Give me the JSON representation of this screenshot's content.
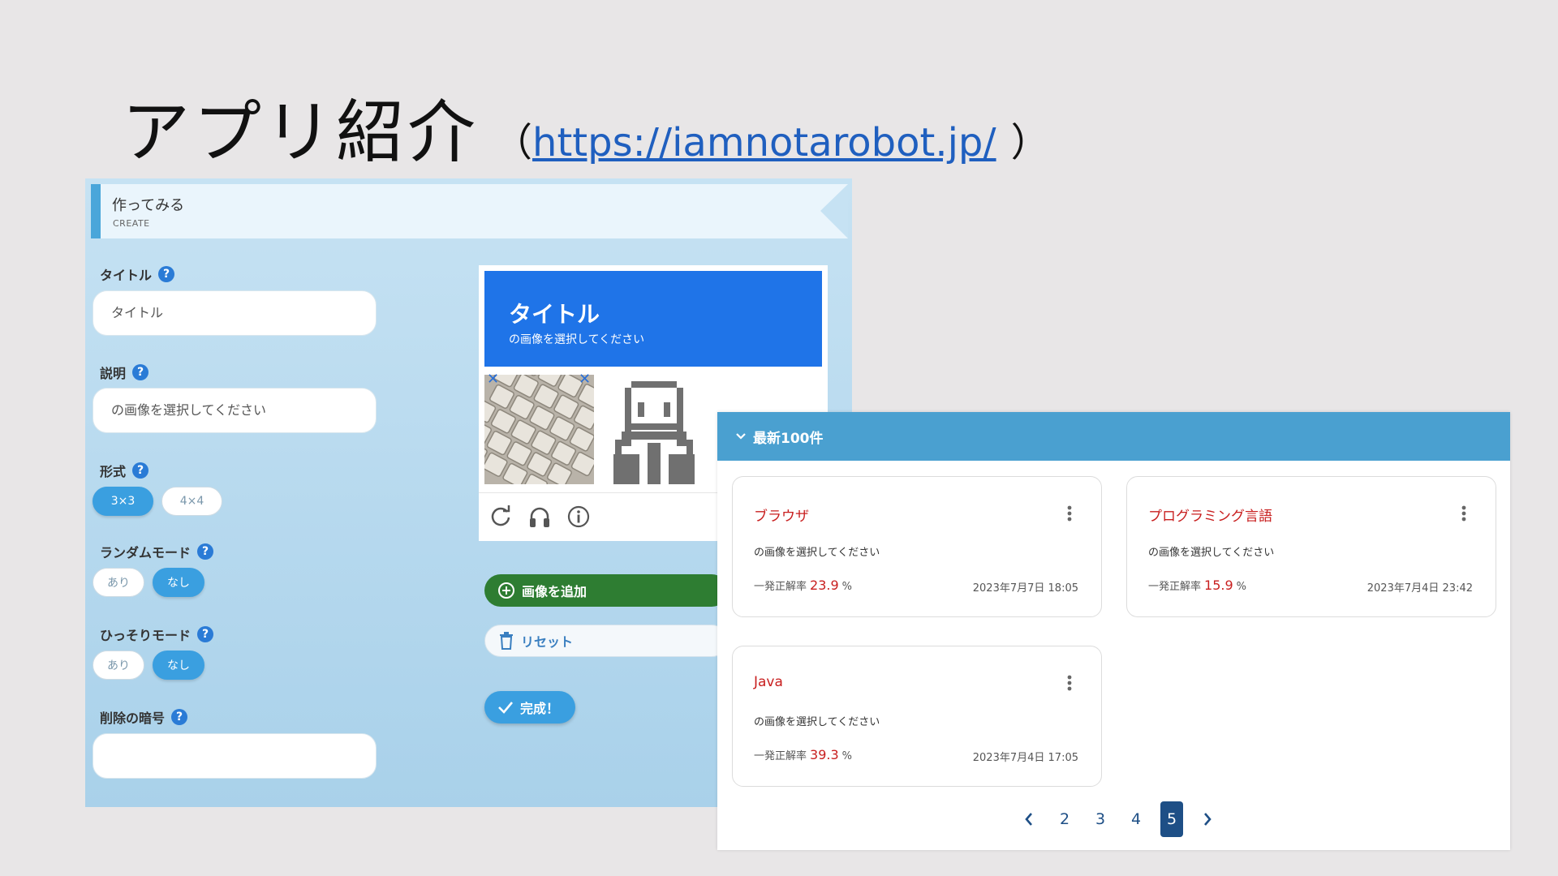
{
  "slide": {
    "title": "アプリ紹介",
    "paren_open": "（",
    "url": "https://iamnotarobot.jp/",
    "paren_close": "）"
  },
  "create": {
    "header_title": "作ってみる",
    "header_sub": "CREATE",
    "title_label": "タイトル",
    "title_value": "タイトル",
    "desc_label": "説明",
    "desc_value": "の画像を選択してください",
    "format_label": "形式",
    "format_options": [
      "3×3",
      "4×4"
    ],
    "format_selected": "3×3",
    "random_label": "ランダムモード",
    "random_options": [
      "あり",
      "なし"
    ],
    "random_selected": "なし",
    "secret_label": "ひっそりモード",
    "secret_options": [
      "あり",
      "なし"
    ],
    "secret_selected": "なし",
    "password_label": "削除の暗号",
    "password_value": "",
    "help_glyph": "?",
    "preview": {
      "title": "タイトル",
      "subtitle": "の画像を選択してください",
      "remove_glyph": "✕",
      "tools": [
        "refresh-icon",
        "headphones-icon",
        "info-icon"
      ]
    },
    "add_image_label": "画像を追加",
    "reset_label": "リセット",
    "done_label": "完成！",
    "colors": {
      "accent": "#3a9fe0",
      "add_green": "#2e7d32",
      "banner": "#1f74e8"
    }
  },
  "recent": {
    "header": "最新100件",
    "rate_label": "一発正解率",
    "cards": [
      {
        "title": "ブラウザ",
        "desc": "の画像を選択してください",
        "rate": "23.9",
        "unit": "%",
        "date": "2023年7月7日 18:05"
      },
      {
        "title": "プログラミング言語",
        "desc": "の画像を選択してください",
        "rate": "15.9",
        "unit": "%",
        "date": "2023年7月4日 23:42"
      },
      {
        "title": "Java",
        "desc": "の画像を選択してください",
        "rate": "39.3",
        "unit": "%",
        "date": "2023年7月4日 17:05"
      }
    ],
    "pagination": {
      "pages": [
        "2",
        "3",
        "4",
        "5"
      ],
      "current": "5"
    }
  }
}
